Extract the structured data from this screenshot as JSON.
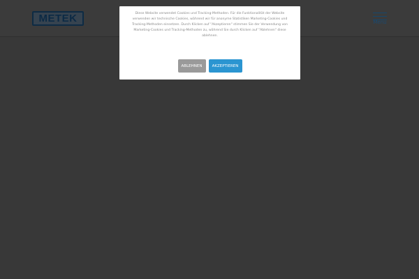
{
  "header": {
    "logo_text": "METEK",
    "menu_label": "Menu"
  },
  "cookie_banner": {
    "text": "Diese Website verwendet Cookies und Tracking-Methoden. Für die Funktionalität der Website verwenden wir technische Cookies, während wir für anonyme Statistiken Marketing-Cookies und Tracking-Methoden einsetzen. Durch Klicken auf \"Akzeptieren\" stimmen Sie der Verwendung von Marketing-Cookies und Tracking-Methoden zu, während Sie durch Klicken auf \"Ablehnen\" diese ablehnen.",
    "decline_label": "ABLEHNEN",
    "accept_label": "AKZEPTIEREN"
  },
  "colors": {
    "accent": "#2b95d1",
    "decline": "#9a9a9a",
    "overlay": "#383838",
    "brand": "#0c2a45"
  },
  "icons": {
    "menu": "hamburger-icon"
  }
}
